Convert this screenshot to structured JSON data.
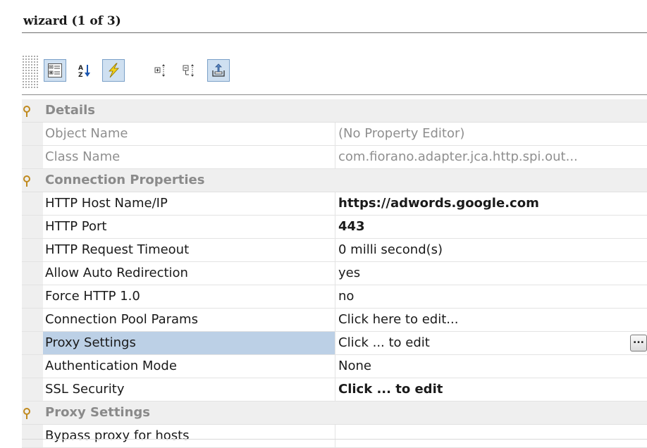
{
  "window": {
    "title": "wizard (1 of 3)"
  },
  "toolbar": {
    "buttons": [
      {
        "name": "categorized-view-icon",
        "toggled": true
      },
      {
        "name": "sort-alphabetical-icon",
        "toggled": false
      },
      {
        "name": "lightning-icon",
        "toggled": true
      },
      {
        "name": "expand-all-icon",
        "toggled": false
      },
      {
        "name": "collapse-all-icon",
        "toggled": false
      },
      {
        "name": "export-icon",
        "toggled": true
      }
    ]
  },
  "sections": {
    "details": {
      "label": "Details",
      "rows": [
        {
          "key": "Object Name",
          "value": "(No Property Editor)"
        },
        {
          "key": "Class Name",
          "value": "com.fiorano.adapter.jca.http.spi.out..."
        }
      ]
    },
    "connection": {
      "label": "Connection Properties",
      "rows": [
        {
          "key": "HTTP Host Name/IP",
          "value": "https://adwords.google.com"
        },
        {
          "key": "HTTP Port",
          "value": "443"
        },
        {
          "key": "HTTP Request Timeout",
          "value": "0 milli second(s)"
        },
        {
          "key": "Allow Auto Redirection",
          "value": "yes"
        },
        {
          "key": "Force HTTP 1.0",
          "value": "no"
        },
        {
          "key": "Connection Pool Params",
          "value": "Click here to edit..."
        },
        {
          "key": "Proxy Settings",
          "value": "Click ... to edit",
          "button": "..."
        },
        {
          "key": "Authentication Mode",
          "value": "None"
        },
        {
          "key": "SSL Security",
          "value": "Click ... to edit"
        }
      ]
    },
    "proxy": {
      "label": "Proxy Settings",
      "rows": [
        {
          "key": "Bypass proxy for hosts",
          "value": ""
        }
      ]
    }
  },
  "colors": {
    "selection": "#bcd0e6",
    "section_bg": "#efefef",
    "section_text": "#8a8a8a",
    "disabled_text": "#8f8f8f",
    "section_icon": "#c08a1e"
  }
}
